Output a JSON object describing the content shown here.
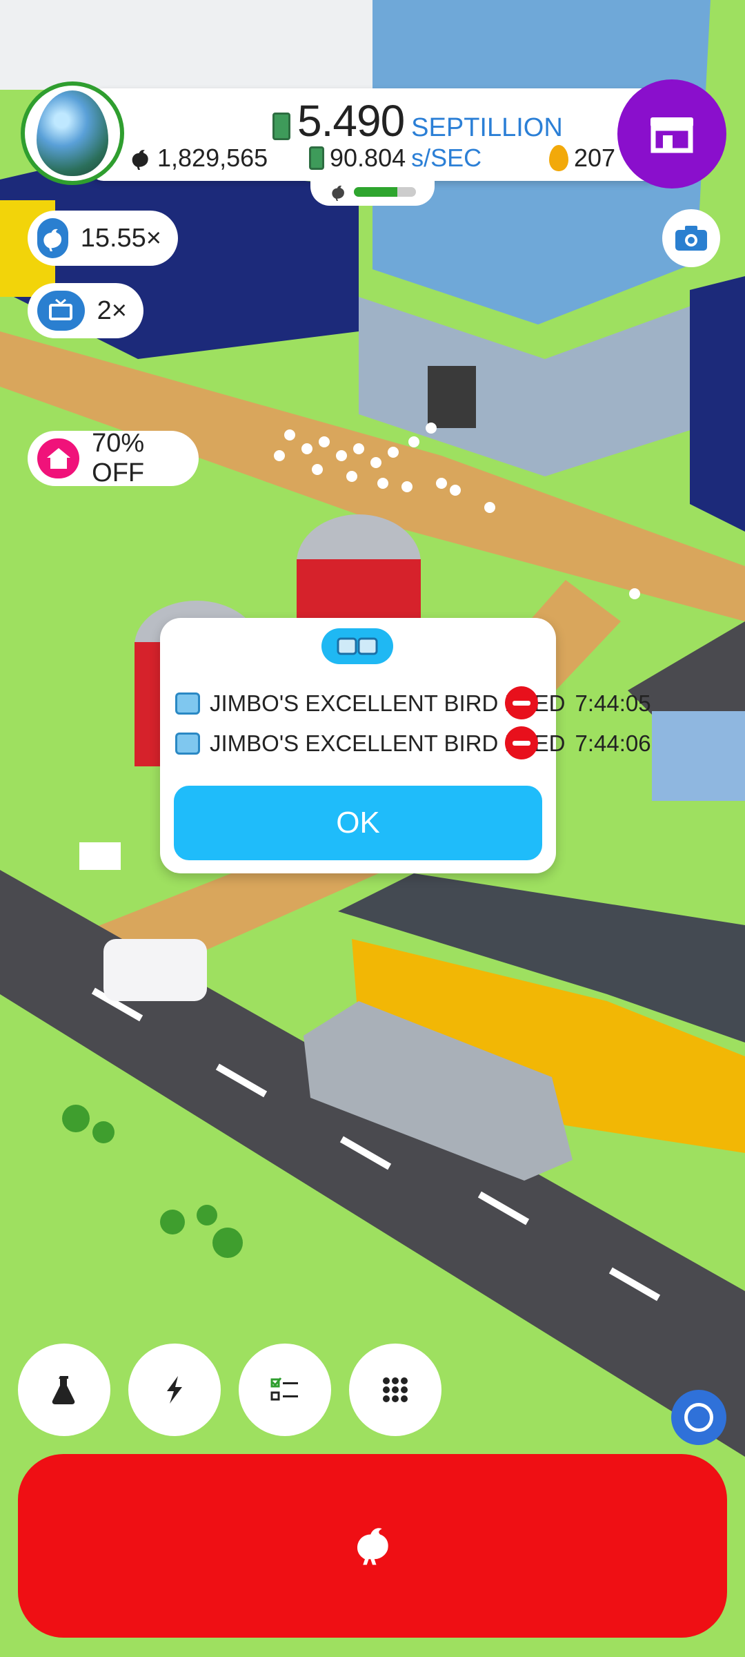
{
  "header": {
    "money_value": "5.490",
    "money_unit": "SEPTILLION",
    "chicken_count": "1,829,565",
    "income_value": "90.804",
    "income_unit": "s/SEC",
    "golden_eggs": "207",
    "hatchery_fill": 0.7
  },
  "boosts": {
    "chicken_multiplier": "15.55×",
    "video_multiplier": "2×",
    "discount": "70% OFF"
  },
  "dialog": {
    "items": [
      {
        "name": "JIMBO'S EXCELLENT BIRD FEED",
        "time": "7:44:05"
      },
      {
        "name": "JIMBO'S EXCELLENT BIRD FEED",
        "time": "7:44:06"
      }
    ],
    "ok_label": "OK"
  },
  "colors": {
    "grass": "#9ee060",
    "road": "#4a4a4f",
    "shop_button": "#8a0fcc",
    "hatch_button": "#ef0f14",
    "ok_button": "#1fbcfa",
    "remove_button": "#e8101c"
  },
  "icons": [
    "egg-avatar-icon",
    "cash-icon",
    "chicken-icon",
    "golden-egg-icon",
    "shop-icon",
    "camera-icon",
    "tv-icon",
    "home-icon",
    "flask-icon",
    "bolt-icon",
    "checklist-icon",
    "grid-icon",
    "assistant-icon"
  ]
}
